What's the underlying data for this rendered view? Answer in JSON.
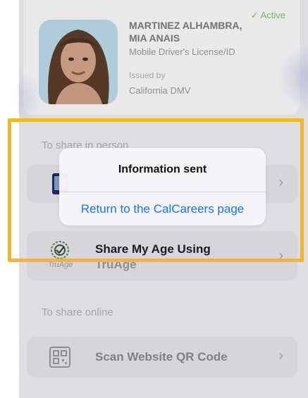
{
  "card": {
    "status": "✓ Active",
    "name_line1": "MARTINEZ ALHAMBRA,",
    "name_line2": "MIA ANAIS",
    "doc_type": "Mobile Driver's License/ID",
    "issued_by_label": "Issued by",
    "issuer": "California DMV"
  },
  "in_person": {
    "section_label": "To share in person",
    "rows": [
      {
        "label": "",
        "icon": "phone-share-icon"
      },
      {
        "label": "Share My Age Using",
        "icon": "truage-icon",
        "sublabel": "TruAge",
        "icon_caption": "TruAge"
      }
    ]
  },
  "online": {
    "section_label": "To share online",
    "rows": [
      {
        "label": "Scan Website QR Code",
        "icon": "qr-code-icon"
      }
    ]
  },
  "alert": {
    "title": "Information sent",
    "action": "Return to the CalCareers page"
  },
  "colors": {
    "highlight": "#f1b82d",
    "action_blue": "#1b73e8",
    "active_green": "#7fc46a"
  }
}
